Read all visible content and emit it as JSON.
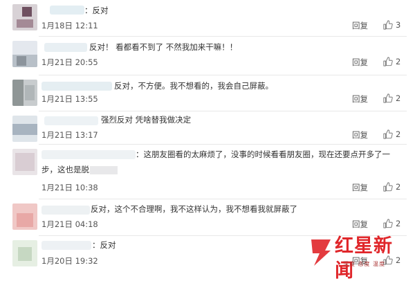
{
  "comments": [
    {
      "text": "：反对",
      "time": "1月18日 12:11",
      "reply": "回复",
      "likes": "3"
    },
    {
      "text": "反对！ 看都看不到了 不然我加来干嘛！！",
      "time": "1月21日 20:55",
      "reply": "回复",
      "likes": "2"
    },
    {
      "text": "反对，不方便。我不想看的，我会自己屏蔽。",
      "time": "1月21日 13:55",
      "reply": "回复",
      "likes": "2"
    },
    {
      "text": "强烈反对 凭啥替我做决定",
      "time": "1月21日 13:17",
      "reply": "回复",
      "likes": "2"
    },
    {
      "text_line1": "：这朋友圈看的太麻烦了，没事的时候看看朋友圈，现在还要点开多了一",
      "text_line2": "步，这也是脱",
      "time": "1月21日 10:38",
      "reply": "回复",
      "likes": "2"
    },
    {
      "text": "反对，这个不合理啊，我不这样认为，我不想看我就屏蔽了",
      "time": "1月21日 04:18",
      "reply": "回复",
      "likes": "2"
    },
    {
      "text": "：反对",
      "time": "1月20日 19:32",
      "reply": "回复",
      "likes": "2"
    }
  ],
  "watermark": {
    "brand": "红星新闻",
    "slogan": "深度 态度 温度"
  },
  "icons": {
    "like": "thumbs-up-icon"
  },
  "colors": {
    "brand": "#e0262a",
    "separator": "#e8e8e8"
  }
}
